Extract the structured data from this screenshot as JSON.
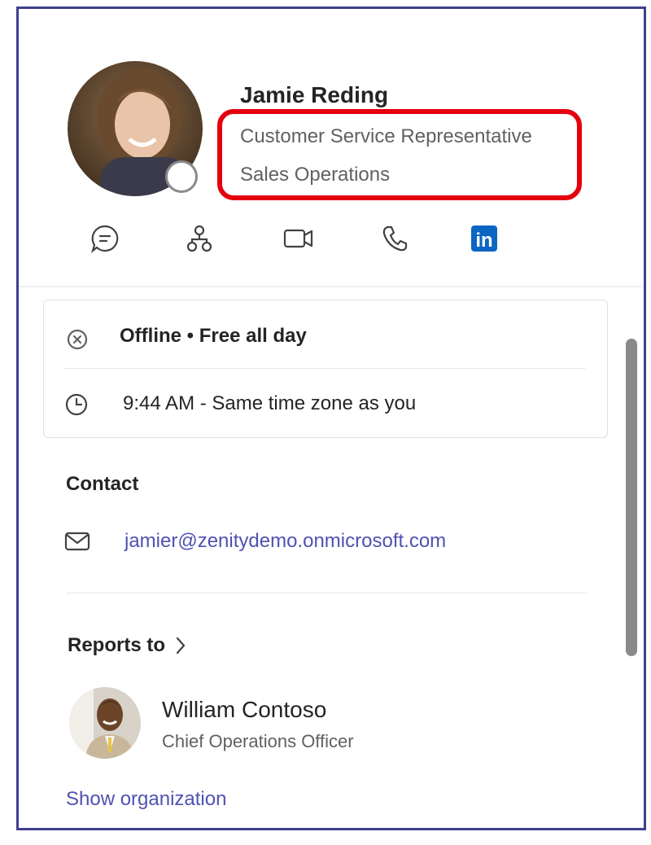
{
  "profile": {
    "name": "Jamie Reding",
    "title": "Customer Service Representative",
    "department": "Sales Operations"
  },
  "actions": [
    {
      "icon": "chat-icon"
    },
    {
      "icon": "org-chart-icon"
    },
    {
      "icon": "video-call-icon"
    },
    {
      "icon": "phone-icon"
    },
    {
      "icon": "linkedin-icon",
      "label": "in"
    }
  ],
  "status": {
    "availability": "Offline • Free all day",
    "local_time": "9:44 AM - Same time zone as you"
  },
  "contact": {
    "heading": "Contact",
    "email": "jamier@zenitydemo.onmicrosoft.com"
  },
  "reports_to": {
    "heading": "Reports to",
    "manager_name": "William Contoso",
    "manager_title": "Chief Operations Officer"
  },
  "show_org_label": "Show organization",
  "colors": {
    "accent": "#4f52b2",
    "linkedin": "#0a66c2",
    "highlight": "#e4000f",
    "frame": "#3f3f8f"
  }
}
